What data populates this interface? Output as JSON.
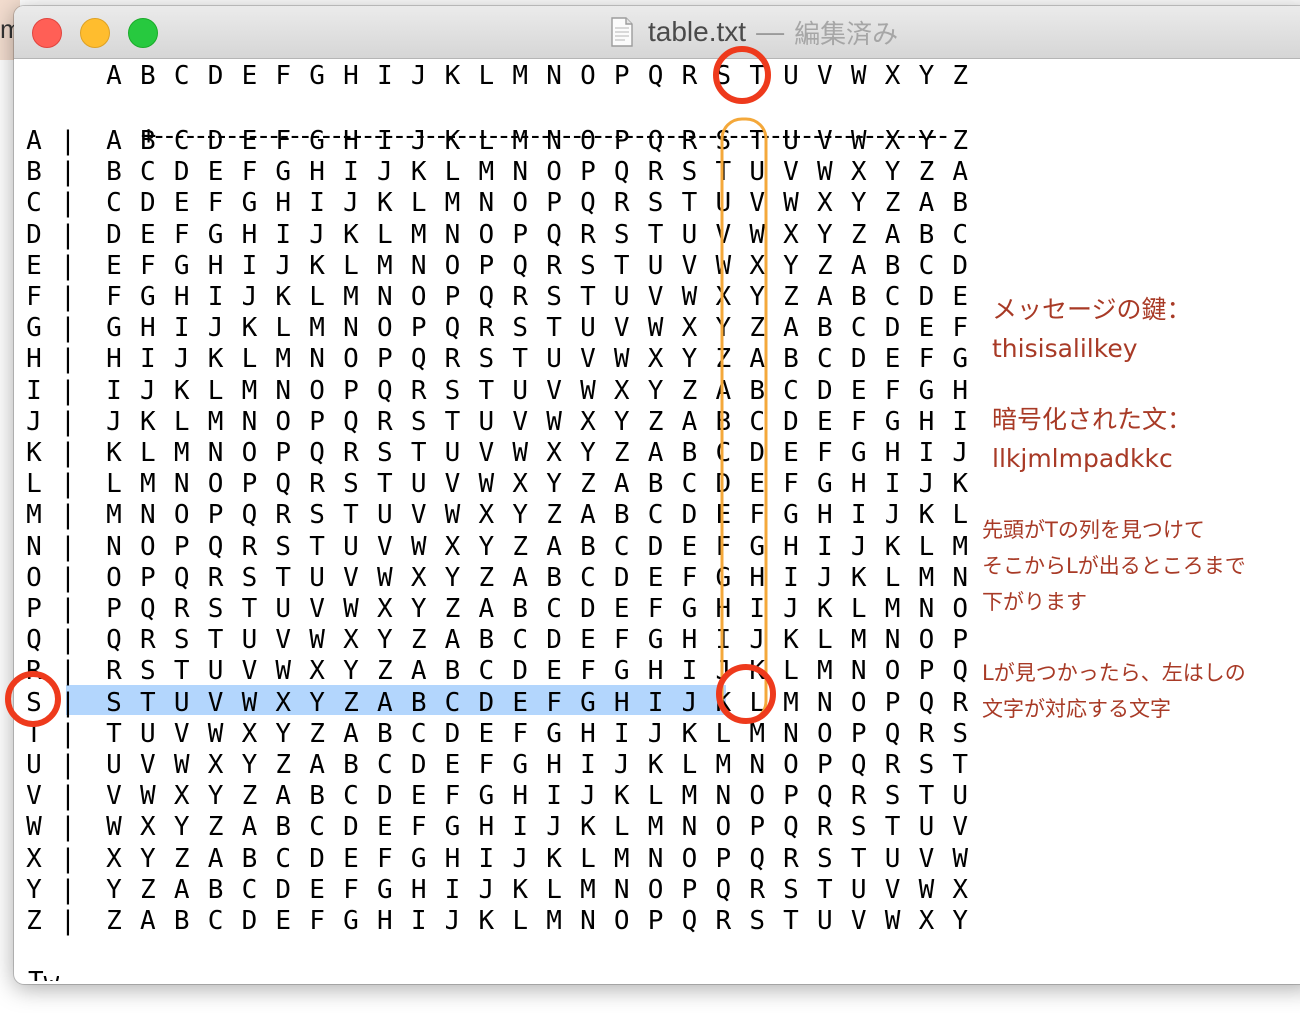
{
  "background": {
    "partial_text": "m"
  },
  "window": {
    "title": "table.txt",
    "title_separator": "—",
    "status": "編集済み"
  },
  "editor": {
    "header_row": [
      "A",
      "B",
      "C",
      "D",
      "E",
      "F",
      "G",
      "H",
      "I",
      "J",
      "K",
      "L",
      "M",
      "N",
      "O",
      "P",
      "Q",
      "R",
      "S",
      "T",
      "U",
      "V",
      "W",
      "X",
      "Y",
      "Z"
    ],
    "corner": "+",
    "separator": "----------------------------------------------------------------------------",
    "bar": "|",
    "rows": [
      {
        "label": "A",
        "cells": [
          "A",
          "B",
          "C",
          "D",
          "E",
          "F",
          "G",
          "H",
          "I",
          "J",
          "K",
          "L",
          "M",
          "N",
          "O",
          "P",
          "Q",
          "R",
          "S",
          "T",
          "U",
          "V",
          "W",
          "X",
          "Y",
          "Z"
        ]
      },
      {
        "label": "B",
        "cells": [
          "B",
          "C",
          "D",
          "E",
          "F",
          "G",
          "H",
          "I",
          "J",
          "K",
          "L",
          "M",
          "N",
          "O",
          "P",
          "Q",
          "R",
          "S",
          "T",
          "U",
          "V",
          "W",
          "X",
          "Y",
          "Z",
          "A"
        ]
      },
      {
        "label": "C",
        "cells": [
          "C",
          "D",
          "E",
          "F",
          "G",
          "H",
          "I",
          "J",
          "K",
          "L",
          "M",
          "N",
          "O",
          "P",
          "Q",
          "R",
          "S",
          "T",
          "U",
          "V",
          "W",
          "X",
          "Y",
          "Z",
          "A",
          "B"
        ]
      },
      {
        "label": "D",
        "cells": [
          "D",
          "E",
          "F",
          "G",
          "H",
          "I",
          "J",
          "K",
          "L",
          "M",
          "N",
          "O",
          "P",
          "Q",
          "R",
          "S",
          "T",
          "U",
          "V",
          "W",
          "X",
          "Y",
          "Z",
          "A",
          "B",
          "C"
        ]
      },
      {
        "label": "E",
        "cells": [
          "E",
          "F",
          "G",
          "H",
          "I",
          "J",
          "K",
          "L",
          "M",
          "N",
          "O",
          "P",
          "Q",
          "R",
          "S",
          "T",
          "U",
          "V",
          "W",
          "X",
          "Y",
          "Z",
          "A",
          "B",
          "C",
          "D"
        ]
      },
      {
        "label": "F",
        "cells": [
          "F",
          "G",
          "H",
          "I",
          "J",
          "K",
          "L",
          "M",
          "N",
          "O",
          "P",
          "Q",
          "R",
          "S",
          "T",
          "U",
          "V",
          "W",
          "X",
          "Y",
          "Z",
          "A",
          "B",
          "C",
          "D",
          "E"
        ]
      },
      {
        "label": "G",
        "cells": [
          "G",
          "H",
          "I",
          "J",
          "K",
          "L",
          "M",
          "N",
          "O",
          "P",
          "Q",
          "R",
          "S",
          "T",
          "U",
          "V",
          "W",
          "X",
          "Y",
          "Z",
          "A",
          "B",
          "C",
          "D",
          "E",
          "F"
        ]
      },
      {
        "label": "H",
        "cells": [
          "H",
          "I",
          "J",
          "K",
          "L",
          "M",
          "N",
          "O",
          "P",
          "Q",
          "R",
          "S",
          "T",
          "U",
          "V",
          "W",
          "X",
          "Y",
          "Z",
          "A",
          "B",
          "C",
          "D",
          "E",
          "F",
          "G"
        ]
      },
      {
        "label": "I",
        "cells": [
          "I",
          "J",
          "K",
          "L",
          "M",
          "N",
          "O",
          "P",
          "Q",
          "R",
          "S",
          "T",
          "U",
          "V",
          "W",
          "X",
          "Y",
          "Z",
          "A",
          "B",
          "C",
          "D",
          "E",
          "F",
          "G",
          "H"
        ]
      },
      {
        "label": "J",
        "cells": [
          "J",
          "K",
          "L",
          "M",
          "N",
          "O",
          "P",
          "Q",
          "R",
          "S",
          "T",
          "U",
          "V",
          "W",
          "X",
          "Y",
          "Z",
          "A",
          "B",
          "C",
          "D",
          "E",
          "F",
          "G",
          "H",
          "I"
        ]
      },
      {
        "label": "K",
        "cells": [
          "K",
          "L",
          "M",
          "N",
          "O",
          "P",
          "Q",
          "R",
          "S",
          "T",
          "U",
          "V",
          "W",
          "X",
          "Y",
          "Z",
          "A",
          "B",
          "C",
          "D",
          "E",
          "F",
          "G",
          "H",
          "I",
          "J"
        ]
      },
      {
        "label": "L",
        "cells": [
          "L",
          "M",
          "N",
          "O",
          "P",
          "Q",
          "R",
          "S",
          "T",
          "U",
          "V",
          "W",
          "X",
          "Y",
          "Z",
          "A",
          "B",
          "C",
          "D",
          "E",
          "F",
          "G",
          "H",
          "I",
          "J",
          "K"
        ]
      },
      {
        "label": "M",
        "cells": [
          "M",
          "N",
          "O",
          "P",
          "Q",
          "R",
          "S",
          "T",
          "U",
          "V",
          "W",
          "X",
          "Y",
          "Z",
          "A",
          "B",
          "C",
          "D",
          "E",
          "F",
          "G",
          "H",
          "I",
          "J",
          "K",
          "L"
        ]
      },
      {
        "label": "N",
        "cells": [
          "N",
          "O",
          "P",
          "Q",
          "R",
          "S",
          "T",
          "U",
          "V",
          "W",
          "X",
          "Y",
          "Z",
          "A",
          "B",
          "C",
          "D",
          "E",
          "F",
          "G",
          "H",
          "I",
          "J",
          "K",
          "L",
          "M"
        ]
      },
      {
        "label": "O",
        "cells": [
          "O",
          "P",
          "Q",
          "R",
          "S",
          "T",
          "U",
          "V",
          "W",
          "X",
          "Y",
          "Z",
          "A",
          "B",
          "C",
          "D",
          "E",
          "F",
          "G",
          "H",
          "I",
          "J",
          "K",
          "L",
          "M",
          "N"
        ]
      },
      {
        "label": "P",
        "cells": [
          "P",
          "Q",
          "R",
          "S",
          "T",
          "U",
          "V",
          "W",
          "X",
          "Y",
          "Z",
          "A",
          "B",
          "C",
          "D",
          "E",
          "F",
          "G",
          "H",
          "I",
          "J",
          "K",
          "L",
          "M",
          "N",
          "O"
        ]
      },
      {
        "label": "Q",
        "cells": [
          "Q",
          "R",
          "S",
          "T",
          "U",
          "V",
          "W",
          "X",
          "Y",
          "Z",
          "A",
          "B",
          "C",
          "D",
          "E",
          "F",
          "G",
          "H",
          "I",
          "J",
          "K",
          "L",
          "M",
          "N",
          "O",
          "P"
        ]
      },
      {
        "label": "R",
        "cells": [
          "R",
          "S",
          "T",
          "U",
          "V",
          "W",
          "X",
          "Y",
          "Z",
          "A",
          "B",
          "C",
          "D",
          "E",
          "F",
          "G",
          "H",
          "I",
          "J",
          "K",
          "L",
          "M",
          "N",
          "O",
          "P",
          "Q"
        ]
      },
      {
        "label": "S",
        "cells": [
          "S",
          "T",
          "U",
          "V",
          "W",
          "X",
          "Y",
          "Z",
          "A",
          "B",
          "C",
          "D",
          "E",
          "F",
          "G",
          "H",
          "I",
          "J",
          "K",
          "L",
          "M",
          "N",
          "O",
          "P",
          "Q",
          "R"
        ]
      },
      {
        "label": "T",
        "cells": [
          "T",
          "U",
          "V",
          "W",
          "X",
          "Y",
          "Z",
          "A",
          "B",
          "C",
          "D",
          "E",
          "F",
          "G",
          "H",
          "I",
          "J",
          "K",
          "L",
          "M",
          "N",
          "O",
          "P",
          "Q",
          "R",
          "S"
        ]
      },
      {
        "label": "U",
        "cells": [
          "U",
          "V",
          "W",
          "X",
          "Y",
          "Z",
          "A",
          "B",
          "C",
          "D",
          "E",
          "F",
          "G",
          "H",
          "I",
          "J",
          "K",
          "L",
          "M",
          "N",
          "O",
          "P",
          "Q",
          "R",
          "S",
          "T"
        ]
      },
      {
        "label": "V",
        "cells": [
          "V",
          "W",
          "X",
          "Y",
          "Z",
          "A",
          "B",
          "C",
          "D",
          "E",
          "F",
          "G",
          "H",
          "I",
          "J",
          "K",
          "L",
          "M",
          "N",
          "O",
          "P",
          "Q",
          "R",
          "S",
          "T",
          "U"
        ]
      },
      {
        "label": "W",
        "cells": [
          "W",
          "X",
          "Y",
          "Z",
          "A",
          "B",
          "C",
          "D",
          "E",
          "F",
          "G",
          "H",
          "I",
          "J",
          "K",
          "L",
          "M",
          "N",
          "O",
          "P",
          "Q",
          "R",
          "S",
          "T",
          "U",
          "V"
        ]
      },
      {
        "label": "X",
        "cells": [
          "X",
          "Y",
          "Z",
          "A",
          "B",
          "C",
          "D",
          "E",
          "F",
          "G",
          "H",
          "I",
          "J",
          "K",
          "L",
          "M",
          "N",
          "O",
          "P",
          "Q",
          "R",
          "S",
          "T",
          "U",
          "V",
          "W"
        ]
      },
      {
        "label": "Y",
        "cells": [
          "Y",
          "Z",
          "A",
          "B",
          "C",
          "D",
          "E",
          "F",
          "G",
          "H",
          "I",
          "J",
          "K",
          "L",
          "M",
          "N",
          "O",
          "P",
          "Q",
          "R",
          "S",
          "T",
          "U",
          "V",
          "W",
          "X"
        ]
      },
      {
        "label": "Z",
        "cells": [
          "Z",
          "A",
          "B",
          "C",
          "D",
          "E",
          "F",
          "G",
          "H",
          "I",
          "J",
          "K",
          "L",
          "M",
          "N",
          "O",
          "P",
          "Q",
          "R",
          "S",
          "T",
          "U",
          "V",
          "W",
          "X",
          "Y"
        ]
      }
    ],
    "selected_row_label": "S",
    "highlighted_column": "T",
    "bottom_partial_text": "Tw"
  },
  "annotations": {
    "key_label": "メッセージの鍵：",
    "key_value": "thisisalilkey",
    "cipher_label": "暗号化された文：",
    "cipher_value": "llkjmlmpadkkc",
    "instruction_1_line1": "先頭がTの列を見つけて",
    "instruction_1_line2": "そこからLが出るところまで",
    "instruction_1_line3": "下がります",
    "instruction_2_line1": "Lが見つかったら、左はしの",
    "instruction_2_line2": "文字が対応する文字",
    "circle_color": "#ee3a1c",
    "column_outline_color": "#f4a83a",
    "text_color": "#a83a26",
    "selection_color": "#b3d6fd"
  }
}
